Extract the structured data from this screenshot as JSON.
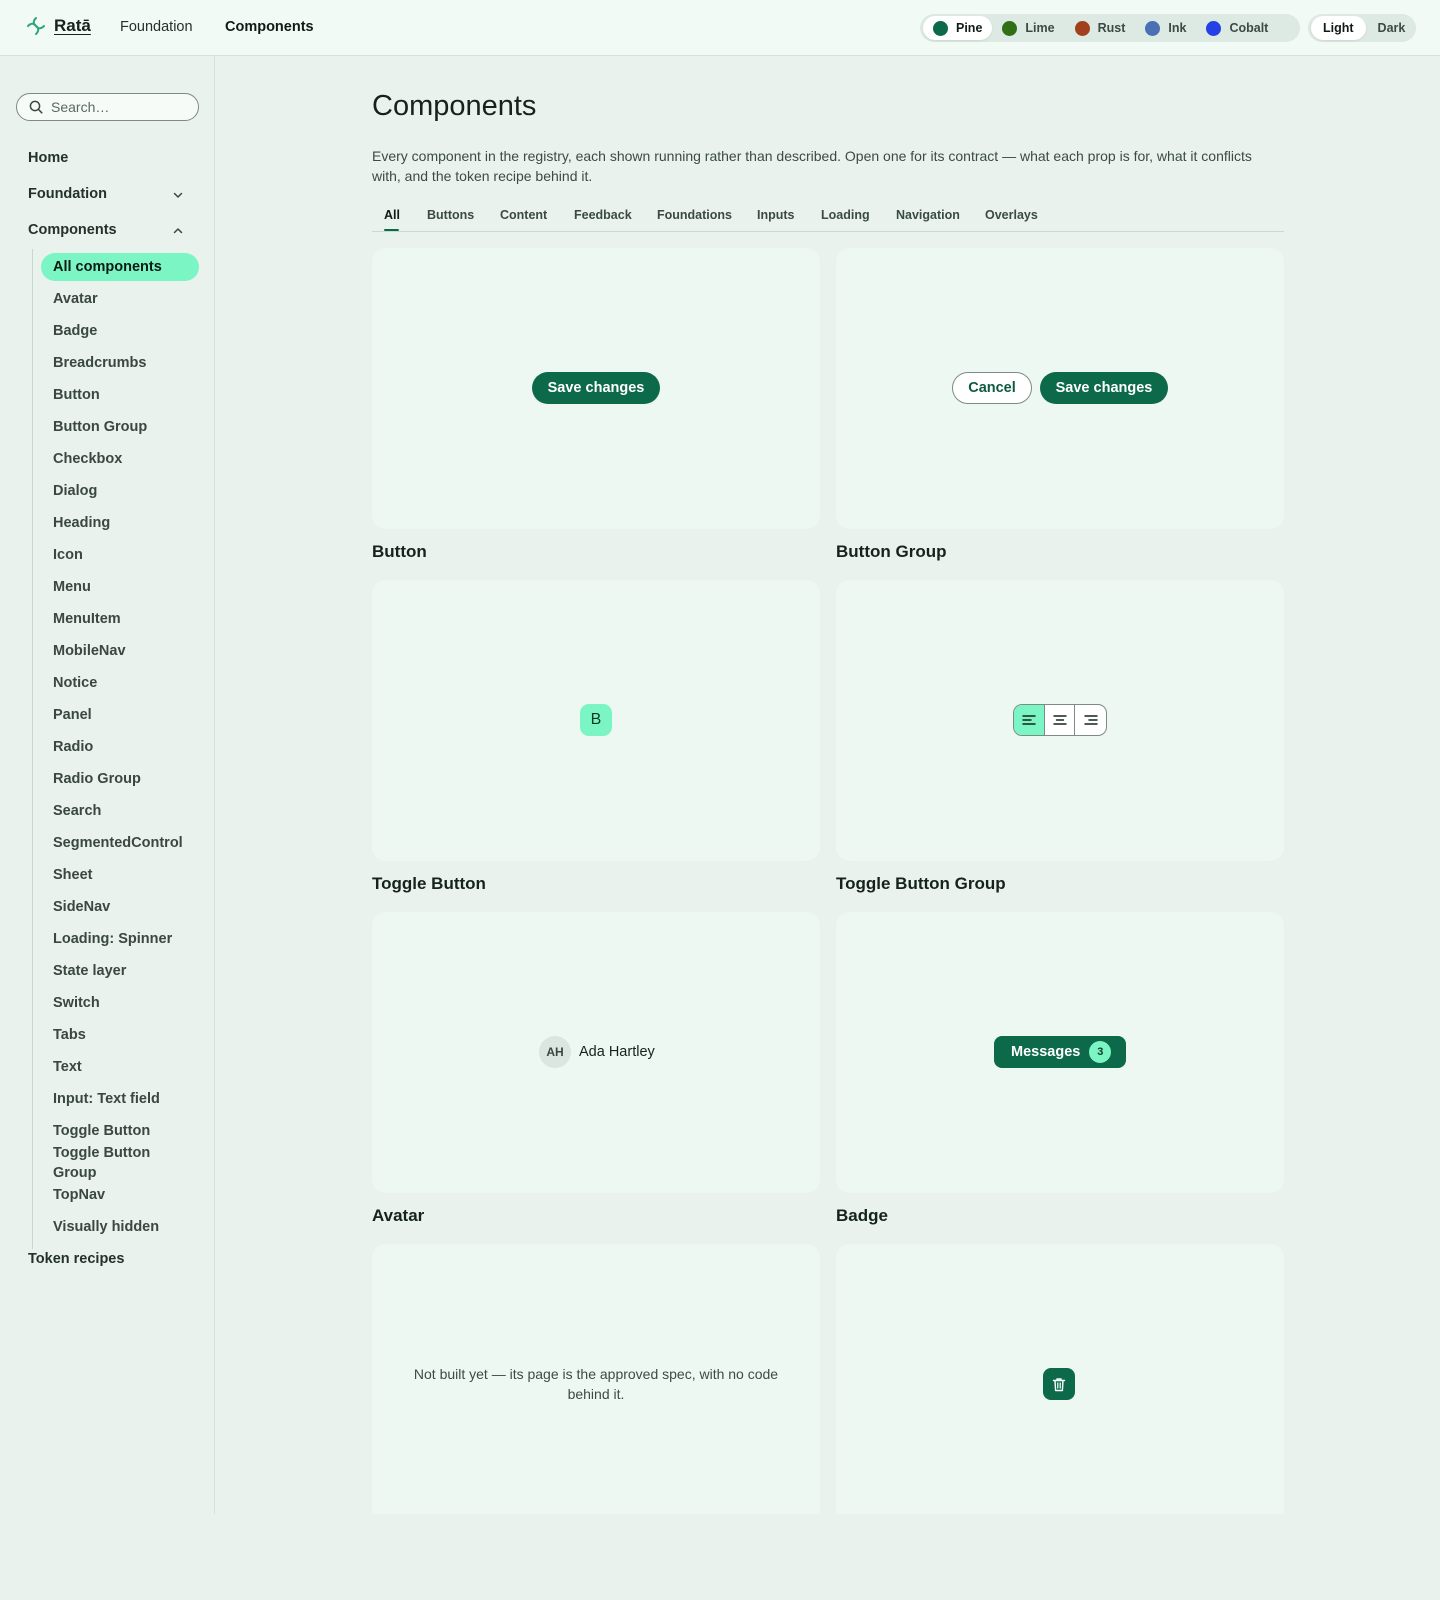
{
  "topnav": {
    "brand": "Ratā",
    "links": [
      "Foundation",
      "Components"
    ],
    "active_link": "Components",
    "palettes": [
      {
        "label": "Pine",
        "color": "#0c6a4a"
      },
      {
        "label": "Lime",
        "color": "#2f6f16"
      },
      {
        "label": "Rust",
        "color": "#a2401d"
      },
      {
        "label": "Ink",
        "color": "#4a6fb4"
      },
      {
        "label": "Cobalt",
        "color": "#2540e6"
      }
    ],
    "active_palette": "Pine",
    "modes": [
      "Light",
      "Dark"
    ],
    "active_mode": "Light"
  },
  "sidebar": {
    "search_placeholder": "Search…",
    "top_items": [
      "Home",
      "Foundation",
      "Components"
    ],
    "component_items": [
      "All components",
      "Avatar",
      "Badge",
      "Breadcrumbs",
      "Button",
      "Button Group",
      "Checkbox",
      "Dialog",
      "Heading",
      "Icon",
      "Menu",
      "MenuItem",
      "MobileNav",
      "Notice",
      "Panel",
      "Radio",
      "Radio Group",
      "Search",
      "SegmentedControl",
      "Sheet",
      "SideNav",
      "Loading: Spinner",
      "State layer",
      "Switch",
      "Tabs",
      "Text",
      "Input: Text field",
      "Toggle Button",
      "Toggle Button Group",
      "TopNav",
      "Visually hidden"
    ],
    "active_item": "All components",
    "footer_item": "Token recipes"
  },
  "main": {
    "title": "Components",
    "description": "Every component in the registry, each shown running rather than described. Open one for its contract — what each prop is for, what it conflicts with, and the token recipe behind it.",
    "tabs": [
      "All",
      "Buttons",
      "Content",
      "Feedback",
      "Foundations",
      "Inputs",
      "Loading",
      "Navigation",
      "Overlays"
    ],
    "active_tab": "All",
    "cards": {
      "button": {
        "title": "Button",
        "demo_label": "Save changes"
      },
      "button_group": {
        "title": "Button Group",
        "cancel_label": "Cancel",
        "save_label": "Save changes"
      },
      "toggle_button": {
        "title": "Toggle Button",
        "demo_label": "B"
      },
      "toggle_button_group": {
        "title": "Toggle Button Group",
        "options": [
          "align-left-icon",
          "align-center-icon",
          "align-right-icon"
        ],
        "active_option": "align-left-icon"
      },
      "avatar": {
        "title": "Avatar",
        "initials": "AH",
        "name": "Ada Hartley"
      },
      "badge": {
        "title": "Badge",
        "label": "Messages",
        "count": "3"
      },
      "breadcrumbs": {
        "message": "Not built yet — its page is the approved spec, with no code behind it."
      },
      "icon": {
        "icon": "trash-icon"
      }
    }
  }
}
